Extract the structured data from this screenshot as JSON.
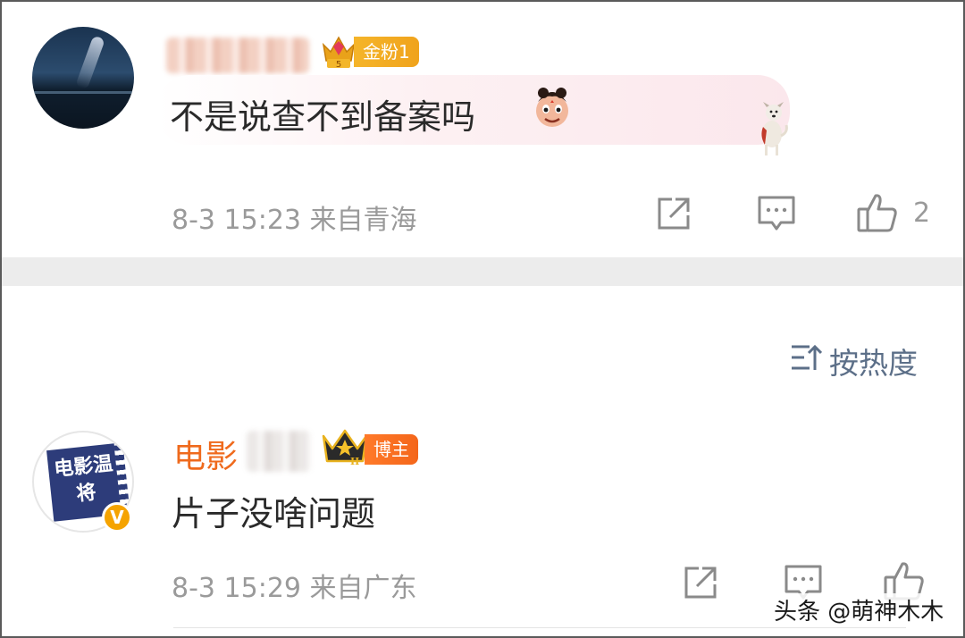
{
  "comments": [
    {
      "name_blurred": true,
      "fan_badge": {
        "level": "5",
        "label": "金粉1",
        "color": "#f0a31c"
      },
      "text": "不是说查不到备案吗",
      "meta": "8-3 15:23 来自青海",
      "actions": {
        "share_icon": "share-icon",
        "comment_icon": "comment-icon",
        "like_icon": "thumbs-up-icon",
        "like_count": "2"
      }
    },
    {
      "name_visible": "电影",
      "name_partially_blurred": true,
      "name_color": "#ef6a1d",
      "avatar_text": "电影温将",
      "verified_mark": "V",
      "role_badge": {
        "level": "II",
        "label": "博主",
        "color": "#f4661a"
      },
      "text": "片子没啥问题",
      "meta": "8-3 15:29 来自广东",
      "actions": {
        "share_icon": "share-icon",
        "comment_icon": "comment-icon",
        "like_icon": "thumbs-up-icon"
      }
    }
  ],
  "sort": {
    "icon": "sort-icon",
    "label": "按热度"
  },
  "watermark": "头条 @萌神木木",
  "colors": {
    "meta_gray": "#9a9a9a",
    "sort_blue": "#5c6f88",
    "divider": "#ececec"
  }
}
